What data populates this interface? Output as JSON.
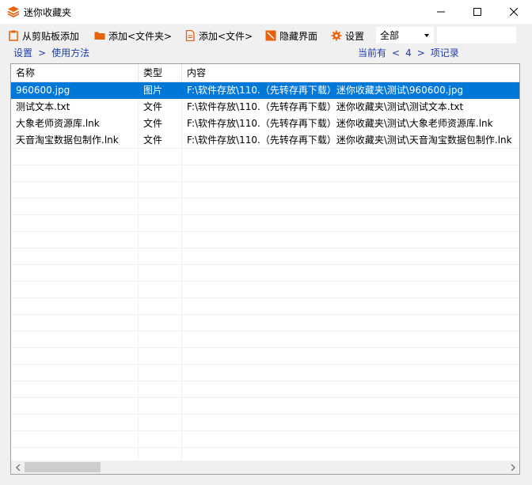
{
  "window": {
    "title": "迷你收藏夹"
  },
  "toolbar": {
    "paste_label": "从剪贴板添加",
    "add_folder_label": "添加<文件夹>",
    "add_file_label": "添加<文件>",
    "hide_label": "隐藏界面",
    "settings_label": "设置",
    "filter_value": "全部",
    "search_value": ""
  },
  "crumbs": {
    "first": "设置",
    "sep": ">",
    "second": "使用方法"
  },
  "pager": {
    "prefix": "当前有",
    "left": "<",
    "count": "4",
    "right": ">",
    "suffix": "项记录"
  },
  "table": {
    "columns": [
      "名称",
      "类型",
      "内容"
    ],
    "rows": [
      {
        "name": "960600.jpg",
        "type": "图片",
        "content": "F:\\软件存放\\110.（先转存再下载）迷你收藏夹\\测试\\960600.jpg"
      },
      {
        "name": "测试文本.txt",
        "type": "文件",
        "content": "F:\\软件存放\\110.（先转存再下载）迷你收藏夹\\测试\\测试文本.txt"
      },
      {
        "name": "大象老师资源库.lnk",
        "type": "文件",
        "content": "F:\\软件存放\\110.（先转存再下载）迷你收藏夹\\测试\\大象老师资源库.lnk"
      },
      {
        "name": "天音淘宝数据包制作.lnk",
        "type": "文件",
        "content": "F:\\软件存放\\110.（先转存再下载）迷你收藏夹\\测试\\天音淘宝数据包制作.lnk"
      }
    ]
  },
  "icons": {
    "app": "stack-icon",
    "paste": "clipboard-icon",
    "folder": "folder-icon",
    "file": "file-icon",
    "hide": "hide-icon",
    "settings": "gear-icon"
  },
  "colors": {
    "accent": "#0078d7",
    "link": "#1a3bb0",
    "icon_orange": "#e8610c"
  }
}
